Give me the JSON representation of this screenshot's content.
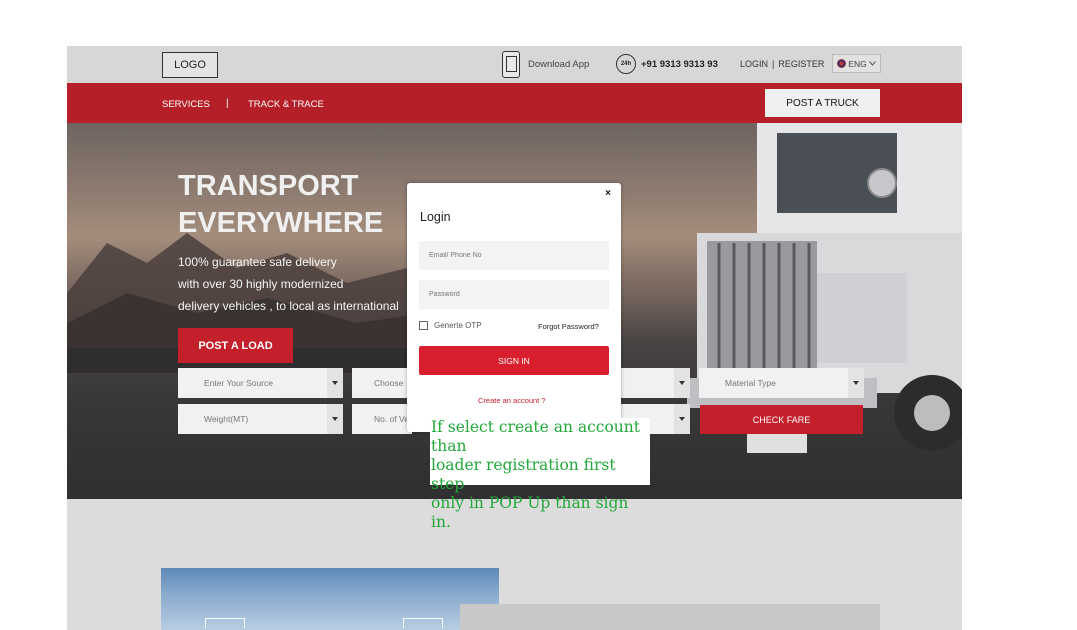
{
  "header": {
    "logo": "LOGO",
    "download_app": "Download App",
    "phone_badge": "24h",
    "phone": "+91 9313 9313 93",
    "login": "LOGIN",
    "auth_sep": "|",
    "register": "REGISTER",
    "language": "ENG"
  },
  "nav": {
    "services": "SERVICES",
    "separator": "|",
    "track": "TRACK & TRACE",
    "post_truck": "POST A TRUCK"
  },
  "hero": {
    "title_line1": "TRANSPORT",
    "title_line2": "EVERYWHERE",
    "line1": "100% guarantee safe delivery",
    "line2": "with over 30 highly modernized",
    "line3": "delivery vehicles , to local as international",
    "post_load": "POST A LOAD"
  },
  "form": {
    "source": "Enter Your Source",
    "choose": "Choose",
    "material": "Material Type",
    "weight": "Weight(MT)",
    "vehicles": "No. of Ve",
    "check_fare": "CHECK FARE"
  },
  "modal": {
    "close": "×",
    "title": "Login",
    "email_placeholder": "Email/ Phone No",
    "password_placeholder": "Password",
    "otp_label": "Generte OTP",
    "forgot": "Forgot Password?",
    "sign_in": "SIGN IN",
    "create_account": "Create an account ?"
  },
  "annotation": {
    "line1": "If select create an account than",
    "line2": "loader registration first step",
    "line3": "only in POP Up than sign in."
  },
  "colors": {
    "brand_red": "#b51f28",
    "button_red": "#d91f2d",
    "note_green": "#22a83a"
  }
}
